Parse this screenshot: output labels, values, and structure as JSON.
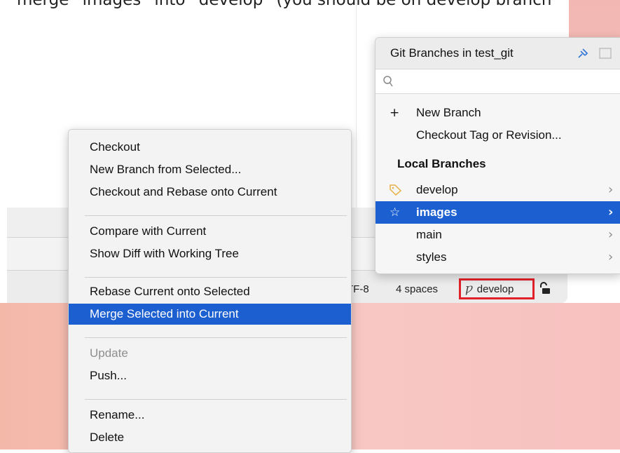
{
  "caption": "merge “images” into “develop” (you should be on develop branch",
  "statusbar": {
    "encoding": "TF-8",
    "indent": "4 spaces",
    "branch": "develop"
  },
  "context_menu": {
    "groups": [
      [
        "Checkout",
        "New Branch from Selected...",
        "Checkout and Rebase onto Current"
      ],
      [
        "Compare with Current",
        "Show Diff with Working Tree"
      ],
      [
        "Rebase Current onto Selected",
        "Merge Selected into Current"
      ],
      [
        "Update",
        "Push..."
      ],
      [
        "Rename...",
        "Delete"
      ]
    ],
    "selected": "Merge Selected into Current",
    "disabled": [
      "Update"
    ]
  },
  "git_popup": {
    "title": "Git Branches in test_git",
    "search_placeholder": "",
    "actions": [
      {
        "icon": "plus-icon",
        "label": "New Branch"
      },
      {
        "icon": "",
        "label": "Checkout Tag or Revision..."
      }
    ],
    "section_title": "Local Branches",
    "branches": [
      {
        "name": "develop",
        "icon": "tag-icon",
        "current": true
      },
      {
        "name": "images",
        "icon": "star-icon",
        "selected": true
      },
      {
        "name": "main",
        "icon": ""
      },
      {
        "name": "styles",
        "icon": ""
      }
    ]
  },
  "colors": {
    "selection": "#1b5fd0",
    "highlight_border": "#e0202a",
    "desktop_pink": "#f6c2be"
  }
}
